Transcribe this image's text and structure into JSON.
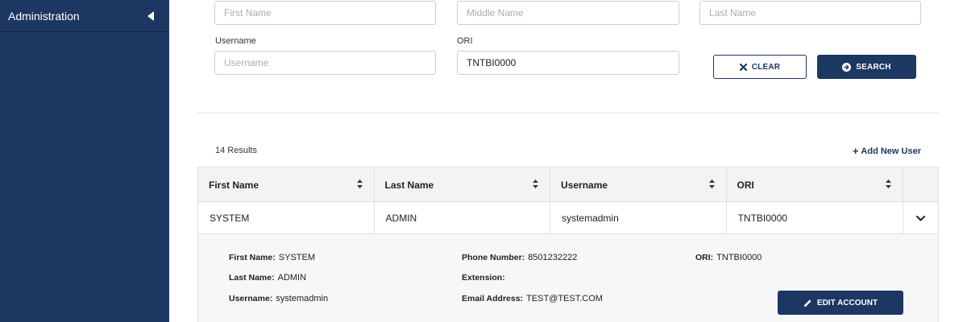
{
  "sidebar": {
    "items": [
      {
        "label": "Administration"
      }
    ]
  },
  "search": {
    "first_name": {
      "placeholder": "First Name",
      "value": ""
    },
    "middle_name": {
      "placeholder": "Middle Name",
      "value": ""
    },
    "last_name": {
      "placeholder": "Last Name",
      "value": ""
    },
    "username": {
      "label": "Username",
      "placeholder": "Username",
      "value": ""
    },
    "ori": {
      "label": "ORI",
      "value": "TNTBI0000"
    },
    "clear_label": "CLEAR",
    "search_label": "SEARCH"
  },
  "results": {
    "count_text": "14 Results",
    "add_user_label": "Add New User",
    "columns": [
      "First Name",
      "Last Name",
      "Username",
      "ORI"
    ],
    "rows": [
      {
        "first_name": "SYSTEM",
        "last_name": "ADMIN",
        "username": "systemadmin",
        "ori": "TNTBI0000"
      }
    ]
  },
  "detail": {
    "first_name": {
      "key": "First Name:",
      "value": "SYSTEM"
    },
    "last_name": {
      "key": "Last Name:",
      "value": "ADMIN"
    },
    "username": {
      "key": "Username:",
      "value": "systemadmin"
    },
    "phone": {
      "key": "Phone Number:",
      "value": "8501232222"
    },
    "extension": {
      "key": "Extension:",
      "value": ""
    },
    "email": {
      "key": "Email Address:",
      "value": "TEST@TEST.COM"
    },
    "ori": {
      "key": "ORI:",
      "value": "TNTBI0000"
    },
    "edit_label": "EDIT ACCOUNT"
  },
  "colors": {
    "sidebar_bg": "#1c3762",
    "primary": "#1c3762",
    "border": "#dde0e5",
    "header_bg": "#f2f3f5",
    "detail_bg": "#f6f7f9"
  },
  "icons": {
    "sidebar_toggle": "triangle-left-icon",
    "clear": "x-icon",
    "search": "arrow-circle-right-icon",
    "add": "plus-icon",
    "sort": "sort-icon",
    "expand": "chevron-down-icon",
    "edit": "pencil-icon"
  }
}
